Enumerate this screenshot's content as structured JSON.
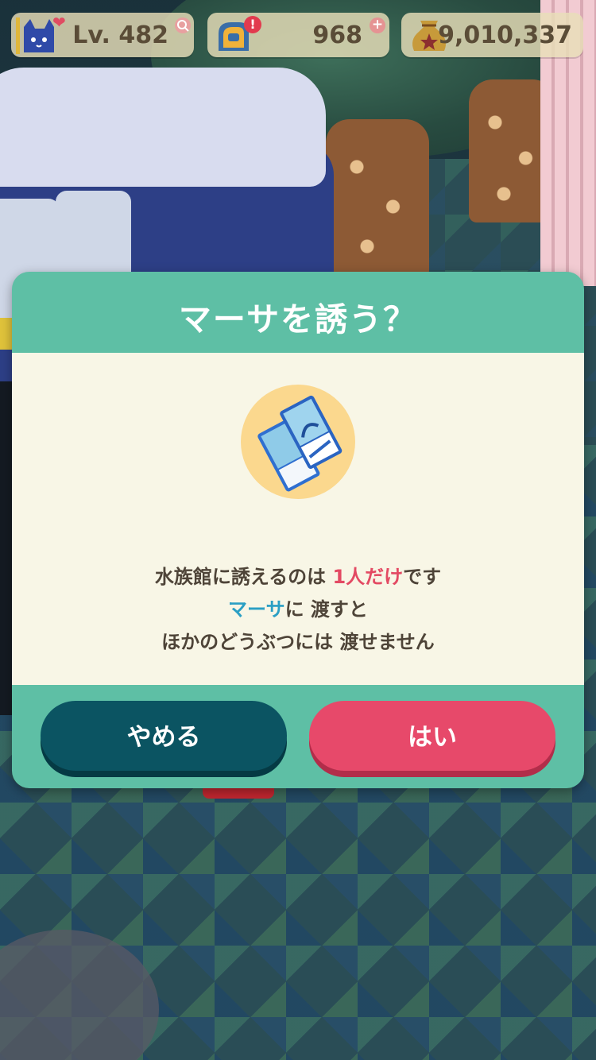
{
  "hud": {
    "level": {
      "text": "Lv. 482",
      "icon": "cat-face-icon",
      "badge_icon": "heart-icon",
      "action_icon": "magnify-plus-icon"
    },
    "tickets": {
      "value": "968",
      "icon": "leaf-ticket-icon",
      "alert_icon": "exclamation-badge-icon",
      "action_icon": "plus-icon",
      "action_glyph": "+"
    },
    "bells": {
      "value": "9,010,337",
      "icon": "bell-bag-icon"
    }
  },
  "dialog": {
    "title": "マーサを誘う？",
    "item_icon": "aquarium-tickets-icon",
    "message": {
      "line1_prefix": "水族館に誘えるのは ",
      "line1_highlight": "1人だけ",
      "line1_suffix": "です",
      "line2_name": "マーサ",
      "line2_suffix": "に 渡すと",
      "line3": "ほかのどうぶつには 渡せません"
    },
    "buttons": {
      "cancel_label": "やめる",
      "ok_label": "はい"
    }
  },
  "colors": {
    "dialog_frame": "#5ebfa5",
    "dialog_body": "#f8f6e6",
    "cancel_button": "#0b5462",
    "ok_button": "#e7496a",
    "highlight_red": "#e34a63",
    "highlight_blue": "#2a9fc4"
  }
}
